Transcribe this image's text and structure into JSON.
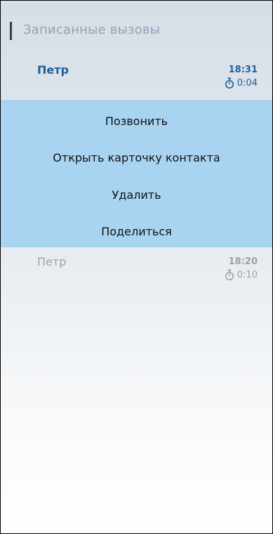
{
  "header": {
    "title": "Записанные вызовы"
  },
  "calls": [
    {
      "name": "Петр",
      "time": "18:31",
      "duration": "0:04",
      "state": "selected"
    },
    {
      "name": "Петр",
      "time": "18:20",
      "duration": "0:10",
      "state": "dimmed"
    }
  ],
  "context_menu": {
    "items": [
      {
        "label": "Позвонить"
      },
      {
        "label": "Открыть карточку контакта"
      },
      {
        "label": "Удалить"
      },
      {
        "label": "Поделиться"
      }
    ]
  },
  "icons": {
    "duration": "stopwatch-icon"
  },
  "colors": {
    "accent": "#1e5f9a",
    "menu_background": "#a8d4f2",
    "header_text": "#8da4b7",
    "dimmed_text": "#9aa2aa"
  }
}
